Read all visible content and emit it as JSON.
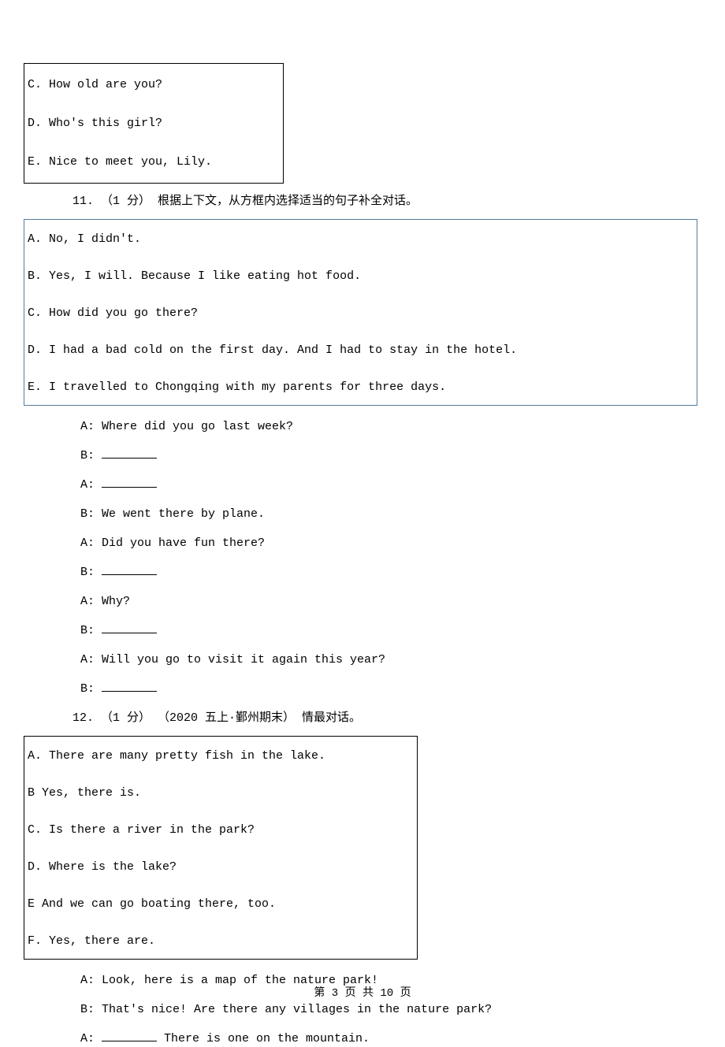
{
  "box1": {
    "c": "C. How old are you?",
    "d": "D. Who's this girl?",
    "e": "E. Nice to meet you, Lily."
  },
  "q11": "11.  （1 分） 根据上下文，从方框内选择适当的句子补全对话。",
  "box2": {
    "a": "A. No, I didn't.",
    "b": "B. Yes, I will. Because I like eating hot food.",
    "c": "C. How did you go there?",
    "d": "D. I had a bad cold on the first day. And I had to stay in the hotel.",
    "e": "E. I travelled to Chongqing with my parents for three days."
  },
  "dialog1": {
    "a1": "A: Where did you go last week?",
    "b1": "B: ",
    "a2": "A: ",
    "b2": "B: We went there by plane.",
    "a3": "A: Did you have fun there?",
    "b3": "B: ",
    "a4": "A: Why?",
    "b4": "B: ",
    "a5": "A: Will you go to visit it again this year?",
    "b5": "B: "
  },
  "q12": "12.  （1 分） （2020 五上·鄞州期末） 情最对话。",
  "box3": {
    "a": "A. There are many pretty fish in the lake.",
    "b": "B Yes, there is.",
    "c": "C. Is there a river in the park?",
    "d": "D. Where is the lake?",
    "e": "E And we can go boating there, too.",
    "f": "F. Yes, there are."
  },
  "dialog2": {
    "a1": "A: Look, here is a map of the nature park!",
    "b1": "B: That's nice! Are there any villages in the nature park?",
    "a2_pre": "A: ",
    "a2_post": "  There is one on the mountain."
  },
  "footer": "第 3 页 共 10 页"
}
